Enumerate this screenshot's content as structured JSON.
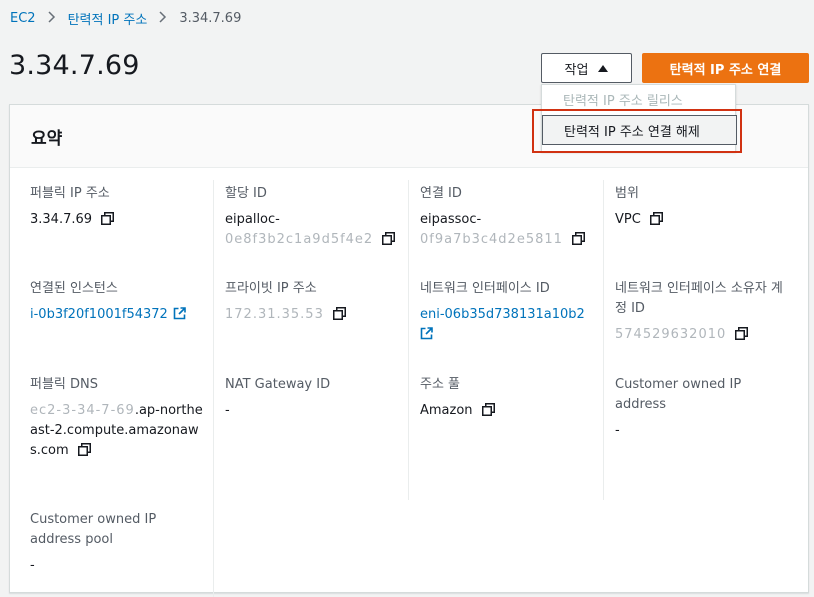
{
  "breadcrumb": {
    "root": "EC2",
    "parent": "탄력적 IP 주소",
    "current": "3.34.7.69"
  },
  "page_title": "3.34.7.69",
  "actions": {
    "label": "작업",
    "primary": "탄력적 IP 주소 연결"
  },
  "dropdown": {
    "items": [
      {
        "label": "탄력적 IP 주소 릴리스",
        "disabled": true
      },
      {
        "label": "탄력적 IP 주소 연결 해제",
        "disabled": false
      }
    ]
  },
  "summary": {
    "title": "요약",
    "public_ip": {
      "label": "퍼블릭 IP 주소",
      "value": "3.34.7.69"
    },
    "allocation_id": {
      "label": "할당 ID",
      "value": "eipalloc-",
      "masked": "0e8f3b2c1a9d5f4e2"
    },
    "association_id": {
      "label": "연결 ID",
      "value": "eipassoc-",
      "masked": "0f9a7b3c4d2e5811"
    },
    "scope": {
      "label": "범위",
      "value": "VPC"
    },
    "instance": {
      "label": "연결된 인스턴스",
      "value": "i-0b3f20f1001f54372"
    },
    "private_ip": {
      "label": "프라이빗 IP 주소",
      "masked": "172.31.35.53"
    },
    "eni": {
      "label": "네트워크 인터페이스 ID",
      "value": "eni-06b35d738131a10b2"
    },
    "eni_owner": {
      "label": "네트워크 인터페이스 소유자 계정 ID",
      "masked": "574529632010"
    },
    "public_dns": {
      "label": "퍼블릭 DNS",
      "masked": "ec2-3-34-7-69",
      "value": ".ap-northeast-2.compute.amazonaws.com"
    },
    "nat_gateway": {
      "label": "NAT Gateway ID",
      "value": "-"
    },
    "address_pool": {
      "label": "주소 풀",
      "value": "Amazon"
    },
    "customer_ip": {
      "label": "Customer owned IP address",
      "value": "-"
    },
    "customer_pool": {
      "label": "Customer owned IP address pool",
      "value": "-"
    }
  },
  "colors": {
    "link": "#0073bb",
    "primary": "#ec7211",
    "highlight": "#d13212"
  }
}
